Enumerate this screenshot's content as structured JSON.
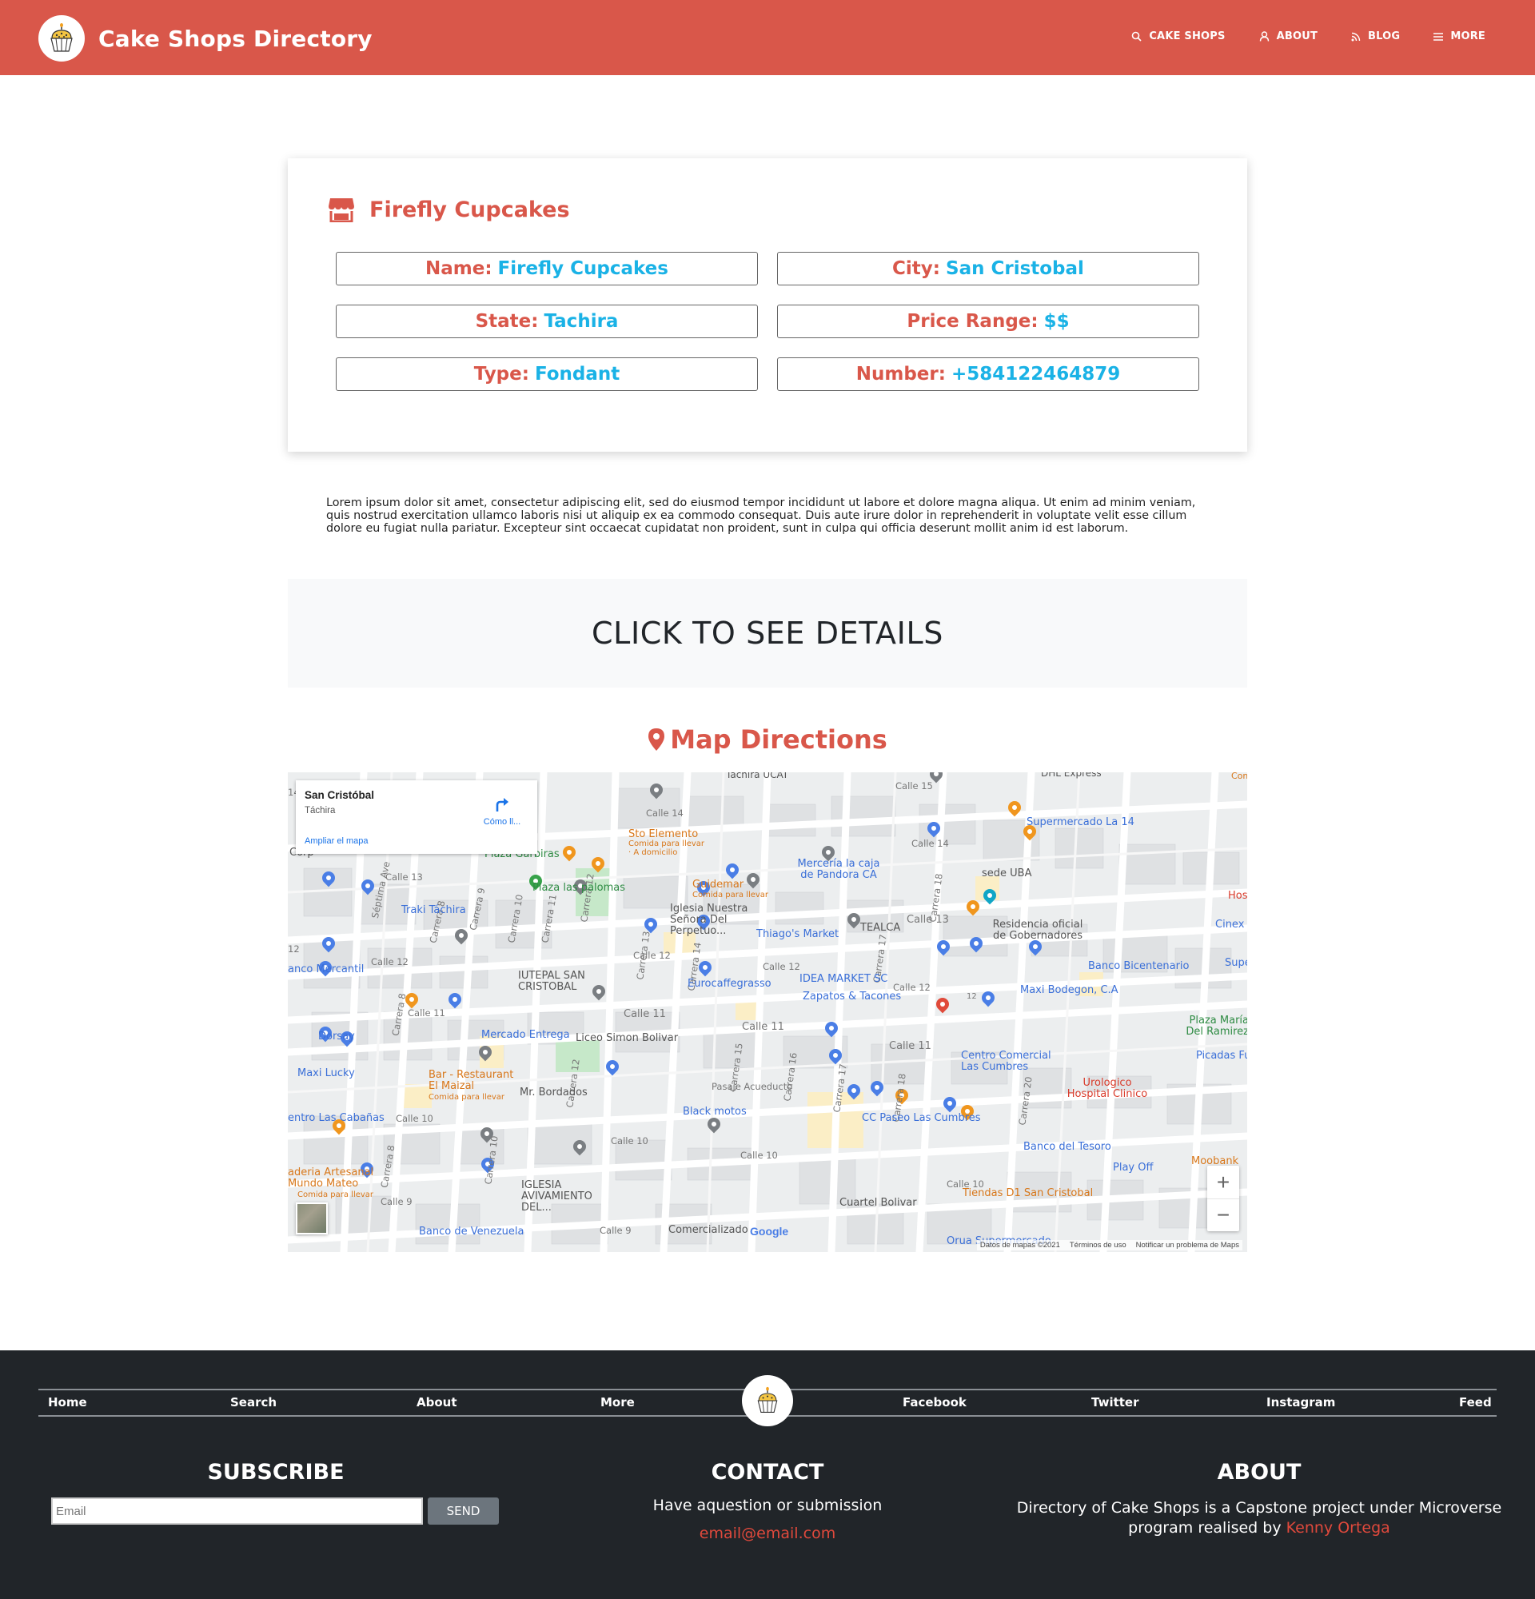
{
  "navbar": {
    "brand_title": "Cake Shops Directory",
    "links": [
      {
        "label": "CAKE SHOPS",
        "icon": "search-icon"
      },
      {
        "label": "ABOUT",
        "icon": "user-icon"
      },
      {
        "label": "BLOG",
        "icon": "rss-icon"
      },
      {
        "label": "MORE",
        "icon": "menu-icon"
      }
    ]
  },
  "shop": {
    "title": "Firefly Cupcakes",
    "fields": {
      "name": {
        "key": "Name:",
        "value": "Firefly Cupcakes"
      },
      "city": {
        "key": "City:",
        "value": "San Cristobal"
      },
      "state": {
        "key": "State:",
        "value": "Tachira"
      },
      "price": {
        "key": "Price Range:",
        "value": "$$"
      },
      "type": {
        "key": "Type:",
        "value": "Fondant"
      },
      "number": {
        "key": "Number:",
        "value": "+584122464879"
      }
    },
    "description": "Lorem ipsum dolor sit amet, consectetur adipiscing elit, sed do eiusmod tempor incididunt ut labore et dolore magna aliqua. Ut enim ad minim veniam, quis nostrud exercitation ullamco laboris nisi ut aliquip ex ea commodo consequat. Duis aute irure dolor in reprehenderit in voluptate velit esse cillum dolore eu fugiat nulla pariatur. Excepteur sint occaecat cupidatat non proident, sunt in culpa qui officia deserunt mollit anim id est laborum."
  },
  "cta_label": "CLICK TO SEE DETAILS",
  "map": {
    "heading": "Map Directions",
    "info_title": "San Cristóbal",
    "info_subtitle": "Táchira",
    "info_link": "Ampliar el mapa",
    "directions_label": "Cómo ll...",
    "zoom_in": "+",
    "zoom_out": "−",
    "google_logo": "Google",
    "attribution": [
      "Datos de mapas ©2021",
      "Términos de uso",
      "Notificar un problema de Maps"
    ],
    "labels": {
      "tachira_ucat": "Táchira UCAT",
      "dhl": "DHL Express",
      "comida_edge": "Comida",
      "calle15": "Calle 15",
      "calle14a": "Calle 14",
      "calle14b": "Calle 14",
      "supermercado": "Supermercado La 14",
      "sto_elemento": "Sto Elemento",
      "sto_sub": "Comida para llevar · A domicilio",
      "plaza_garbiras": "Plaza Garbiras",
      "corp": "Corp",
      "calle13a": "Calle 13",
      "guidemar": "Guidemar",
      "guidemar_sub": "Comida para llevar",
      "merceria": "Mercería la caja de Pandora CA",
      "sede_uba": "sede UBA",
      "plaza_palomas": "Plaza las palomas",
      "traki": "Traki Táchira",
      "iglesia": "Iglesia Nuestra Señora Del Perpetuo...",
      "tealca": "TEALCA",
      "calle13b": "Calle 13",
      "residencia": "Residencia oficial de Gobernadores",
      "hos": "Hos",
      "cinex": "Cinex",
      "thiagos": "Thiago's Market",
      "calle12a": "Calle 12",
      "calle12b": "Calle 12",
      "calle12c": "Calle 12",
      "calle12d": "Calle 12",
      "banco_merc": "anco Mercantil",
      "iutepal": "IUTEPAL SAN CRISTOBAL",
      "eurocaffe": "Eurocaffegrasso",
      "idea_market": "IDEA MARKET SC",
      "banco_bicentenario": "Banco Bicentenario",
      "maxi_bodegon": "Maxi Bodegon, C.A",
      "supe": "Supe",
      "zapatos": "Zapatos & Tacones",
      "calle11a": "Calle 11",
      "calle11b": "Calle 11",
      "calle11c": "Calle 11",
      "calle11d": "Calle 11",
      "dorsay": "Dorsay",
      "mercado_entrega": "Mercado Entrega",
      "liceo": "Liceo Simon Bolivar",
      "plaza_maria": "Plaza María Del Ramirez",
      "centro_comercial": "Centro Comercial Las Cumbres",
      "picadas": "Picadas Fu",
      "maxi_lucky": "Maxi Lucky",
      "bar_restaurant": "Bar - Restaurant El Maizal",
      "bar_sub": "Comida para llevar",
      "pasaje": "Pasaje Acueducto",
      "urologico": "Urologico Hospital Clinico",
      "mr_bordados": "Mr. Bordados",
      "entro_cabanas": "entro Las Cabañas",
      "calle10a": "Calle 10",
      "calle10b": "Calle 10",
      "calle10c": "Calle 10",
      "calle10d": "Calle 10",
      "black_motos": "Black motos",
      "cc_paseo": "CC Paseo Las Cumbres",
      "banco_tesoro": "Banco del Tesoro",
      "play_off": "Play Off",
      "moobank": "Moobank",
      "panaderia": "aderia Artesanal Mundo Mateo",
      "panaderia_sub": "Comida para llevar",
      "iglesia_av": "IGLESIA AVIVAMIENTO DEL...",
      "cuartel": "Cuartel Bolivar",
      "tiendas_d1": "Tiendas D1 San Cristobal",
      "banco_venezuela": "Banco de Venezuela",
      "calle9a": "Calle 9",
      "calle9b": "Calle 9",
      "comercializado": "Comercializado",
      "orua": "Orua Supermercado",
      "septima": "Séptima Ave",
      "carrera8a": "Carrera 8",
      "carrera8b": "Carrera 8",
      "carrera8c": "Carrera 8",
      "carrera9": "Carrera 9",
      "carrera10a": "Carrera 10",
      "carrera10b": "Carrera 10",
      "carrera11": "Carrera 11",
      "carrera12a": "Carrera 12",
      "carrera12b": "Carrera 12",
      "carrera13": "Carrera 13",
      "carrera14": "Carrera 14",
      "carrera15": "Carrera 15",
      "carrera16": "Carrera 16",
      "carrera17a": "Carrera 17",
      "carrera17b": "Carrera 17",
      "carrera18a": "Carrera 18",
      "carrera18b": "Carrera 18",
      "carrera20": "Carrera 20",
      "n12": "12",
      "n14": "14",
      "route12": "12"
    }
  },
  "footer": {
    "nav": [
      "Home",
      "Search",
      "About",
      "More",
      "Facebook",
      "Twitter",
      "Instagram",
      "Feed"
    ],
    "subscribe_title": "SUBSCRIBE",
    "email_placeholder": "Email",
    "send_label": "SEND",
    "contact_title": "CONTACT",
    "contact_text": "Have aquestion or submission",
    "contact_email": "email@email.com",
    "about_title": "ABOUT",
    "about_text": "Directory of Cake Shops is a Capstone project under Microverse program realised by",
    "about_author": "Kenny Ortega"
  },
  "colors": {
    "brand": "#d9574a",
    "accent_value": "#1ab2e6",
    "footer_bg": "#212529",
    "link_red": "#e0493c"
  }
}
